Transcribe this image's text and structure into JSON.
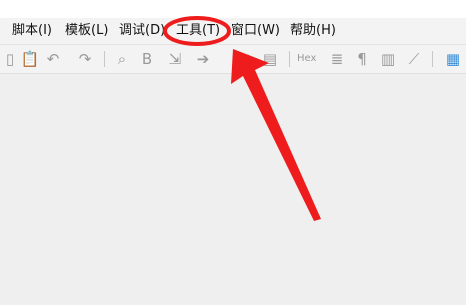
{
  "menu": {
    "items": [
      {
        "label": "脚本(I)"
      },
      {
        "label": "模板(L)"
      },
      {
        "label": "调试(D)"
      },
      {
        "label": "工具(T)"
      },
      {
        "label": "窗口(W)"
      },
      {
        "label": "帮助(H)"
      }
    ]
  },
  "toolbar": {
    "hex_label": "Hex",
    "icons": [
      "new-file-icon",
      "paste-icon",
      "undo-icon",
      "redo-icon",
      "find-icon",
      "replace-icon",
      "goto-icon",
      "forward-icon",
      "bookmark-icon",
      "print-icon",
      "hex-toggle-icon",
      "settings-icon",
      "paragraph-icon",
      "columns-icon",
      "tool-icon",
      "calculator-icon"
    ]
  },
  "annotation": {
    "highlight_color": "#ee1c1c",
    "arrow_color": "#ee1c1c"
  }
}
